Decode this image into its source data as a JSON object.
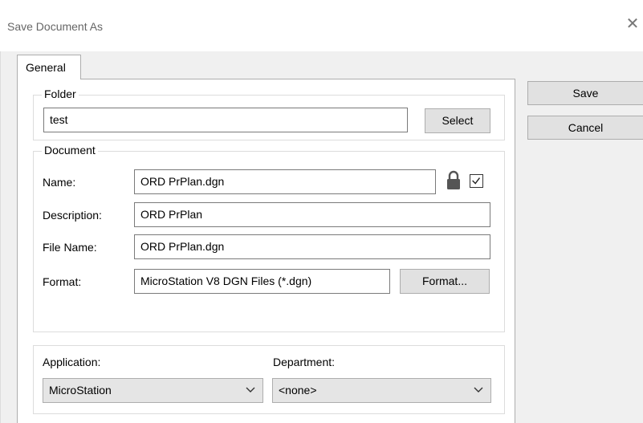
{
  "window": {
    "title": "Save Document As",
    "close_icon": "close-icon"
  },
  "tabs": [
    {
      "label": "General"
    }
  ],
  "folder": {
    "legend": "Folder",
    "value": "test",
    "select_label": "Select"
  },
  "document": {
    "legend": "Document",
    "name_label": "Name:",
    "name_value": "ORD PrPlan.dgn",
    "description_label": "Description:",
    "description_value": "ORD PrPlan",
    "filename_label": "File Name:",
    "filename_value": "ORD PrPlan.dgn",
    "format_label": "Format:",
    "format_value": "MicroStation V8 DGN Files (*.dgn)",
    "format_button": "Format...",
    "lock_icon": "lock-icon",
    "checkbox_checked": true
  },
  "application": {
    "label": "Application:",
    "value": "MicroStation"
  },
  "department": {
    "label": "Department:",
    "value": "<none>"
  },
  "actions": {
    "save_label": "Save",
    "cancel_label": "Cancel"
  }
}
